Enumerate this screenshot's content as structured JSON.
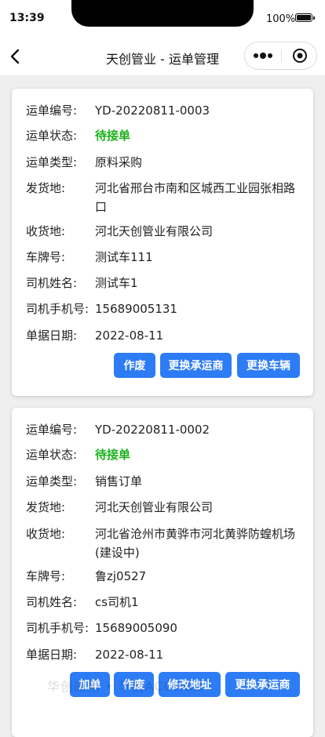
{
  "status_bar": {
    "time": "13:39",
    "battery": "100%"
  },
  "nav": {
    "title": "天创管业 - 运单管理"
  },
  "orders": [
    {
      "fields": [
        {
          "label": "运单编号:",
          "value": "YD-20220811-0003"
        },
        {
          "label": "运单状态:",
          "value": "待接单"
        },
        {
          "label": "运单类型:",
          "value": "原料采购"
        },
        {
          "label": "发货地:",
          "value": "河北省邢台市南和区城西工业园张相路口"
        },
        {
          "label": "收货地:",
          "value": "河北天创管业有限公司"
        },
        {
          "label": "车牌号:",
          "value": "测试车111"
        },
        {
          "label": "司机姓名:",
          "value": "测试车1"
        },
        {
          "label": "司机手机号:",
          "value": "15689005131"
        },
        {
          "label": "单据日期:",
          "value": "2022-08-11"
        }
      ],
      "actions": [
        "作废",
        "更换承运商",
        "更换车辆"
      ]
    },
    {
      "fields": [
        {
          "label": "运单编号:",
          "value": "YD-20220811-0002"
        },
        {
          "label": "运单状态:",
          "value": "待接单"
        },
        {
          "label": "运单类型:",
          "value": "销售订单"
        },
        {
          "label": "发货地:",
          "value": "河北天创管业有限公司"
        },
        {
          "label": "收货地:",
          "value": "河北省沧州市黄骅市河北黄骅防蝗机场(建设中)"
        },
        {
          "label": "车牌号:",
          "value": "鲁zj0527"
        },
        {
          "label": "司机姓名:",
          "value": "cs司机1"
        },
        {
          "label": "司机手机号:",
          "value": "15689005090"
        },
        {
          "label": "单据日期:",
          "value": "2022-08-11"
        }
      ],
      "actions": [
        "加单",
        "作废",
        "修改地址",
        "更换承运商"
      ]
    }
  ],
  "watermark": "华创应用 • 华创ACCHGZ"
}
